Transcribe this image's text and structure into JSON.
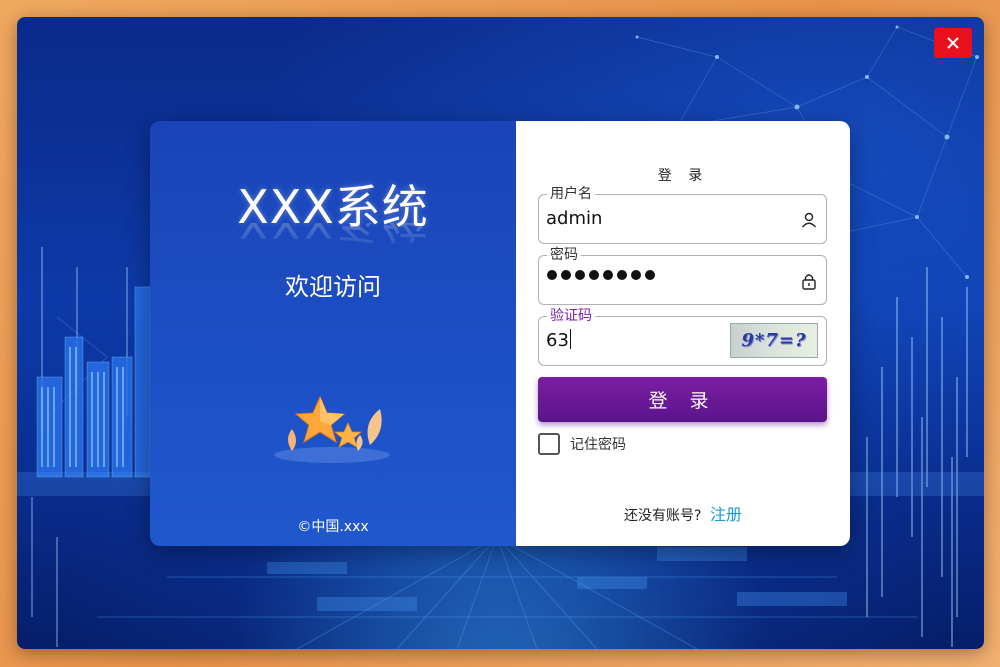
{
  "window": {
    "close_icon": "close-icon"
  },
  "left_panel": {
    "system_title": "XXX系统",
    "welcome_text": "欢迎访问",
    "copyright": "©中国.xxx",
    "mascot_icon": "star-mascot-icon"
  },
  "login_form": {
    "title": "登 录",
    "username": {
      "label": "用户名",
      "value": "admin",
      "icon": "user-icon"
    },
    "password": {
      "label": "密码",
      "masked_length": 8,
      "icon": "lock-icon"
    },
    "captcha": {
      "label": "验证码",
      "value": "63",
      "image_text": "9*7=?"
    },
    "submit_label": "登 录",
    "remember_label": "记住密码",
    "remember_checked": false,
    "register_prompt": "还没有账号?",
    "register_link": "注册"
  },
  "colors": {
    "close_button": "#e8101a",
    "left_panel": "#1d4fc4",
    "submit_button": "#6a1a96",
    "captcha_label": "#7b1fa2",
    "register_link": "#1a9bd7"
  }
}
